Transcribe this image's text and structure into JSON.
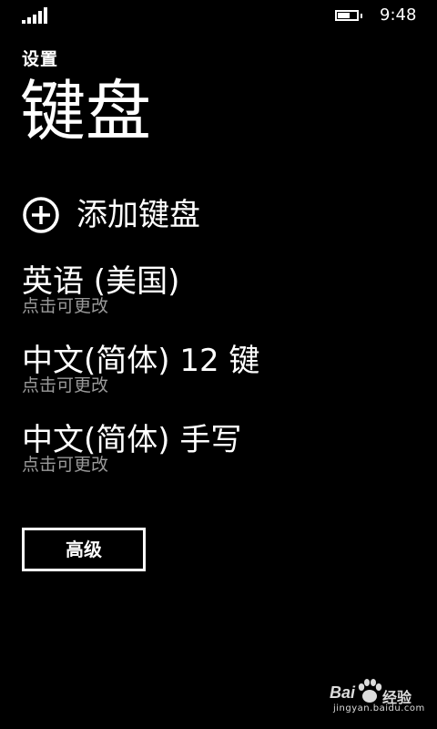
{
  "status_bar": {
    "time": "9:48",
    "signal_bars": 5,
    "battery_level": 0.6
  },
  "header": {
    "app_title": "设置",
    "page_title": "键盘"
  },
  "add_keyboard": {
    "icon": "plus-circle-icon",
    "label": "添加键盘"
  },
  "keyboards": [
    {
      "name": "英语 (美国)",
      "hint": "点击可更改"
    },
    {
      "name": "中文(简体) 12 键",
      "hint": "点击可更改"
    },
    {
      "name": "中文(简体) 手写",
      "hint": "点击可更改"
    }
  ],
  "advanced_button": {
    "label": "高级"
  },
  "watermark": {
    "brand_left": "Bai",
    "brand_paw": "paw-icon",
    "brand_right": "经验",
    "url": "jingyan.baidu.com"
  },
  "colors": {
    "background": "#000000",
    "text": "#ffffff",
    "hint": "#9a9a9a"
  }
}
